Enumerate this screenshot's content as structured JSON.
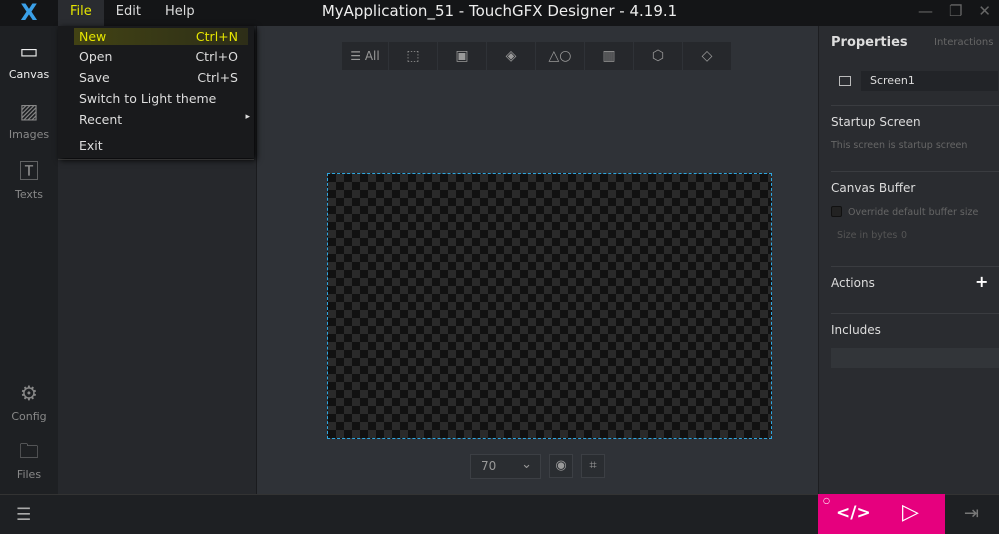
{
  "app": {
    "title": "MyApplication_51 - TouchGFX Designer - 4.19.1",
    "logo": "X"
  },
  "menu": {
    "file": "File",
    "edit": "Edit",
    "help": "Help"
  },
  "file_menu": [
    {
      "label": "New",
      "shortcut": "Ctrl+N"
    },
    {
      "label": "Open",
      "shortcut": "Ctrl+O"
    },
    {
      "label": "Save",
      "shortcut": "Ctrl+S"
    },
    {
      "label": "Switch to Light theme",
      "shortcut": ""
    },
    {
      "label": "Recent",
      "shortcut": "▸"
    },
    {
      "label": "Exit",
      "shortcut": ""
    }
  ],
  "nav": {
    "canvas": "Canvas",
    "images": "Images",
    "texts": "Texts",
    "config": "Config",
    "files": "Files"
  },
  "toolbar": {
    "all": "All"
  },
  "zoom": {
    "value": "70"
  },
  "properties": {
    "tab_properties": "Properties",
    "tab_interactions": "Interactions",
    "screen_name": "Screen1",
    "startup_title": "Startup Screen",
    "startup_text": "This screen is startup screen",
    "buffer_title": "Canvas Buffer",
    "buffer_override": "Override default buffer size",
    "size_label": "Size in bytes",
    "size_value": "0",
    "actions": "Actions",
    "add": "+",
    "includes": "Includes"
  },
  "colors": {
    "accent": "#e6007e",
    "highlight": "#e6e600",
    "canvas_border": "#2ea6e0"
  }
}
